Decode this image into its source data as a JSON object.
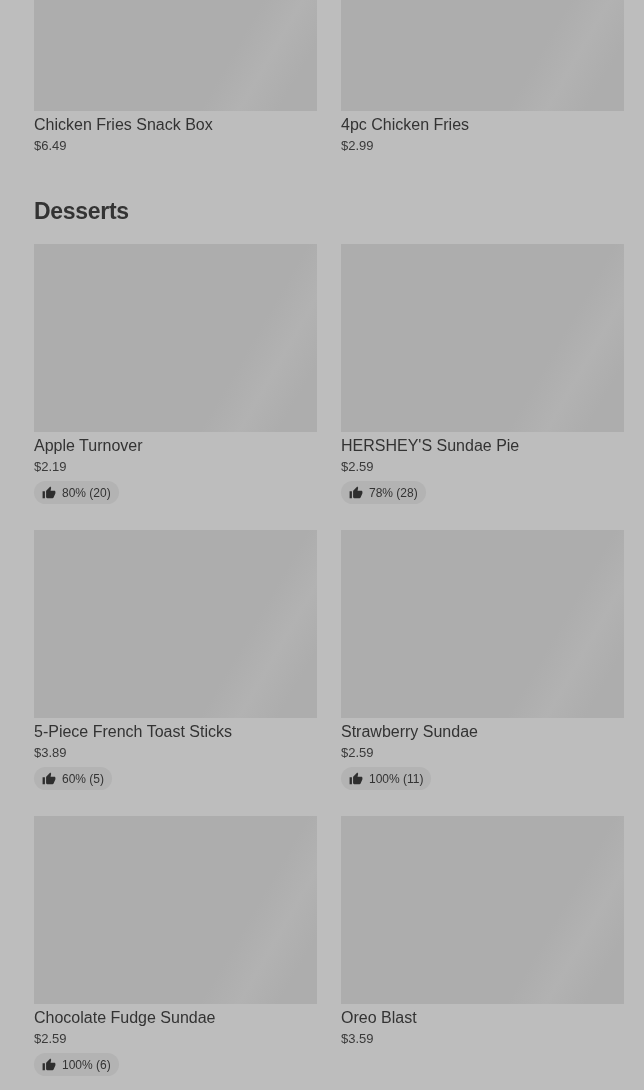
{
  "sections": [
    {
      "items": [
        {
          "name": "Chicken Fries Snack Box",
          "price": "$6.49"
        },
        {
          "name": "4pc Chicken Fries",
          "price": "$2.99"
        }
      ]
    },
    {
      "title": "Desserts",
      "items": [
        {
          "name": "Apple Turnover",
          "price": "$2.19",
          "rating": "80% (20)"
        },
        {
          "name": "HERSHEY'S Sundae Pie",
          "price": "$2.59",
          "rating": "78% (28)"
        },
        {
          "name": "5-Piece French Toast Sticks",
          "price": "$3.89",
          "rating": "60% (5)"
        },
        {
          "name": "Strawberry Sundae",
          "price": "$2.59",
          "rating": "100% (11)"
        },
        {
          "name": "Chocolate Fudge Sundae",
          "price": "$2.59",
          "rating": "100% (6)"
        },
        {
          "name": "Oreo Blast",
          "price": "$3.59"
        }
      ]
    }
  ]
}
